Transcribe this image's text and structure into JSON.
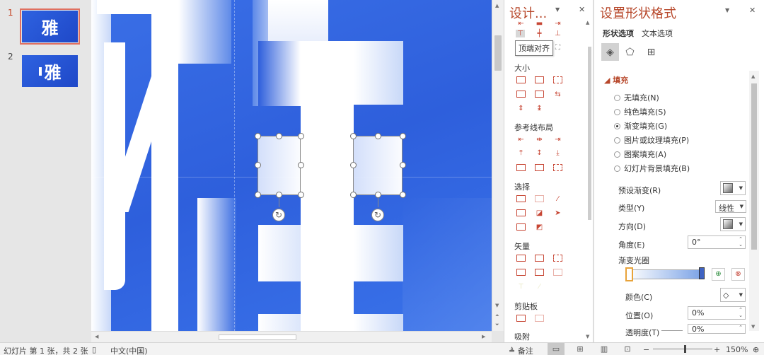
{
  "slides": [
    {
      "number": "1",
      "text": "雅",
      "active": true
    },
    {
      "number": "2",
      "text": "雅",
      "active": false
    }
  ],
  "design_pane": {
    "title": "设计...",
    "tooltip": "顶端对齐",
    "sections": [
      "大小",
      "参考线布局",
      "选择",
      "矢量",
      "剪贴板",
      "吸附"
    ]
  },
  "format_pane": {
    "title": "设置形状格式",
    "tabs": [
      "形状选项",
      "文本选项"
    ],
    "fill_header": "填充",
    "fill_options": [
      {
        "label": "无填充(N)",
        "selected": false
      },
      {
        "label": "纯色填充(S)",
        "selected": false
      },
      {
        "label": "渐变填充(G)",
        "selected": true
      },
      {
        "label": "图片或纹理填充(P)",
        "selected": false
      },
      {
        "label": "图案填充(A)",
        "selected": false
      },
      {
        "label": "幻灯片背景填充(B)",
        "selected": false
      }
    ],
    "preset_label": "预设渐变(R)",
    "type_label": "类型(Y)",
    "type_value": "线性",
    "direction_label": "方向(D)",
    "angle_label": "角度(E)",
    "angle_value": "0°",
    "stops_label": "渐变光圈",
    "color_label": "颜色(C)",
    "position_label": "位置(O)",
    "position_value": "0%",
    "transparency_label": "透明度(T)",
    "transparency_value": "0%"
  },
  "status": {
    "slide_info": "幻灯片 第 1 张，共 2 张",
    "language": "中文(中国)",
    "notes": "备注",
    "zoom_minus": "−",
    "zoom_plus": "+",
    "zoom": "150%"
  },
  "colors": {
    "canvas_blue": "#2e5fdc",
    "accent": "#b7472a",
    "icon_red": "#c74634"
  }
}
